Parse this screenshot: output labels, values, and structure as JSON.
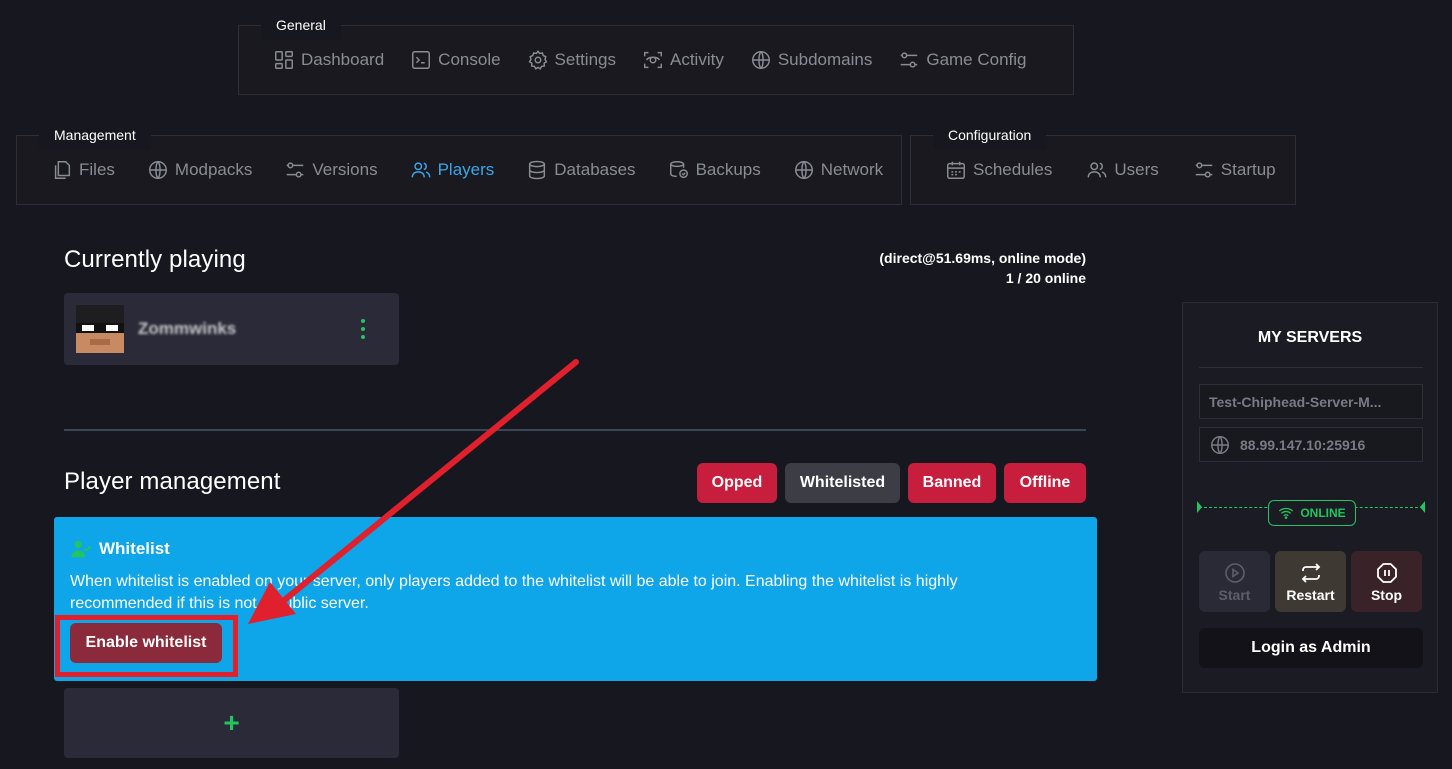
{
  "nav": {
    "general": {
      "title": "General",
      "items": [
        {
          "label": "Dashboard",
          "icon": "dashboard-icon"
        },
        {
          "label": "Console",
          "icon": "console-icon"
        },
        {
          "label": "Settings",
          "icon": "gear-icon"
        },
        {
          "label": "Activity",
          "icon": "activity-icon"
        },
        {
          "label": "Subdomains",
          "icon": "globe-icon"
        },
        {
          "label": "Game Config",
          "icon": "sliders-icon"
        }
      ]
    },
    "management": {
      "title": "Management",
      "items": [
        {
          "label": "Files",
          "icon": "files-icon"
        },
        {
          "label": "Modpacks",
          "icon": "globe-icon"
        },
        {
          "label": "Versions",
          "icon": "sliders-icon"
        },
        {
          "label": "Players",
          "icon": "users-icon",
          "active": true
        },
        {
          "label": "Databases",
          "icon": "database-icon"
        },
        {
          "label": "Backups",
          "icon": "backup-icon"
        },
        {
          "label": "Network",
          "icon": "globe-icon"
        }
      ]
    },
    "configuration": {
      "title": "Configuration",
      "items": [
        {
          "label": "Schedules",
          "icon": "calendar-icon"
        },
        {
          "label": "Users",
          "icon": "users-icon"
        },
        {
          "label": "Startup",
          "icon": "sliders-icon"
        }
      ]
    }
  },
  "currently_playing": {
    "title": "Currently playing",
    "status_line1": "(direct@51.69ms, online mode)",
    "status_line2": "1 / 20 online",
    "players": [
      {
        "name": "Zommwinks"
      }
    ]
  },
  "player_management": {
    "title": "Player management",
    "filters": [
      {
        "label": "Opped",
        "color": "#c81e3e"
      },
      {
        "label": "Whitelisted",
        "color": "#3d3d45"
      },
      {
        "label": "Banned",
        "color": "#c81e3e"
      },
      {
        "label": "Offline",
        "color": "#c81e3e"
      }
    ],
    "whitelist": {
      "title": "Whitelist",
      "description": "When whitelist is enabled on your server, only players added to the whitelist will be able to join. Enabling the whitelist is highly recommended if this is not a public server.",
      "enable_button": "Enable whitelist"
    },
    "add_symbol": "+"
  },
  "sidebar": {
    "title": "MY SERVERS",
    "server_name": "Test-Chiphead-Server-M...",
    "address": "88.99.147.10:25916",
    "status": "ONLINE",
    "buttons": {
      "start": "Start",
      "restart": "Restart",
      "stop": "Stop"
    },
    "login_admin": "Login as Admin"
  },
  "colors": {
    "accent_blue": "#3aa6e8",
    "whitelist_panel": "#0ea5e9",
    "danger": "#c81e3e",
    "online_green": "#22c55e",
    "annotation_red": "#e0202c"
  }
}
